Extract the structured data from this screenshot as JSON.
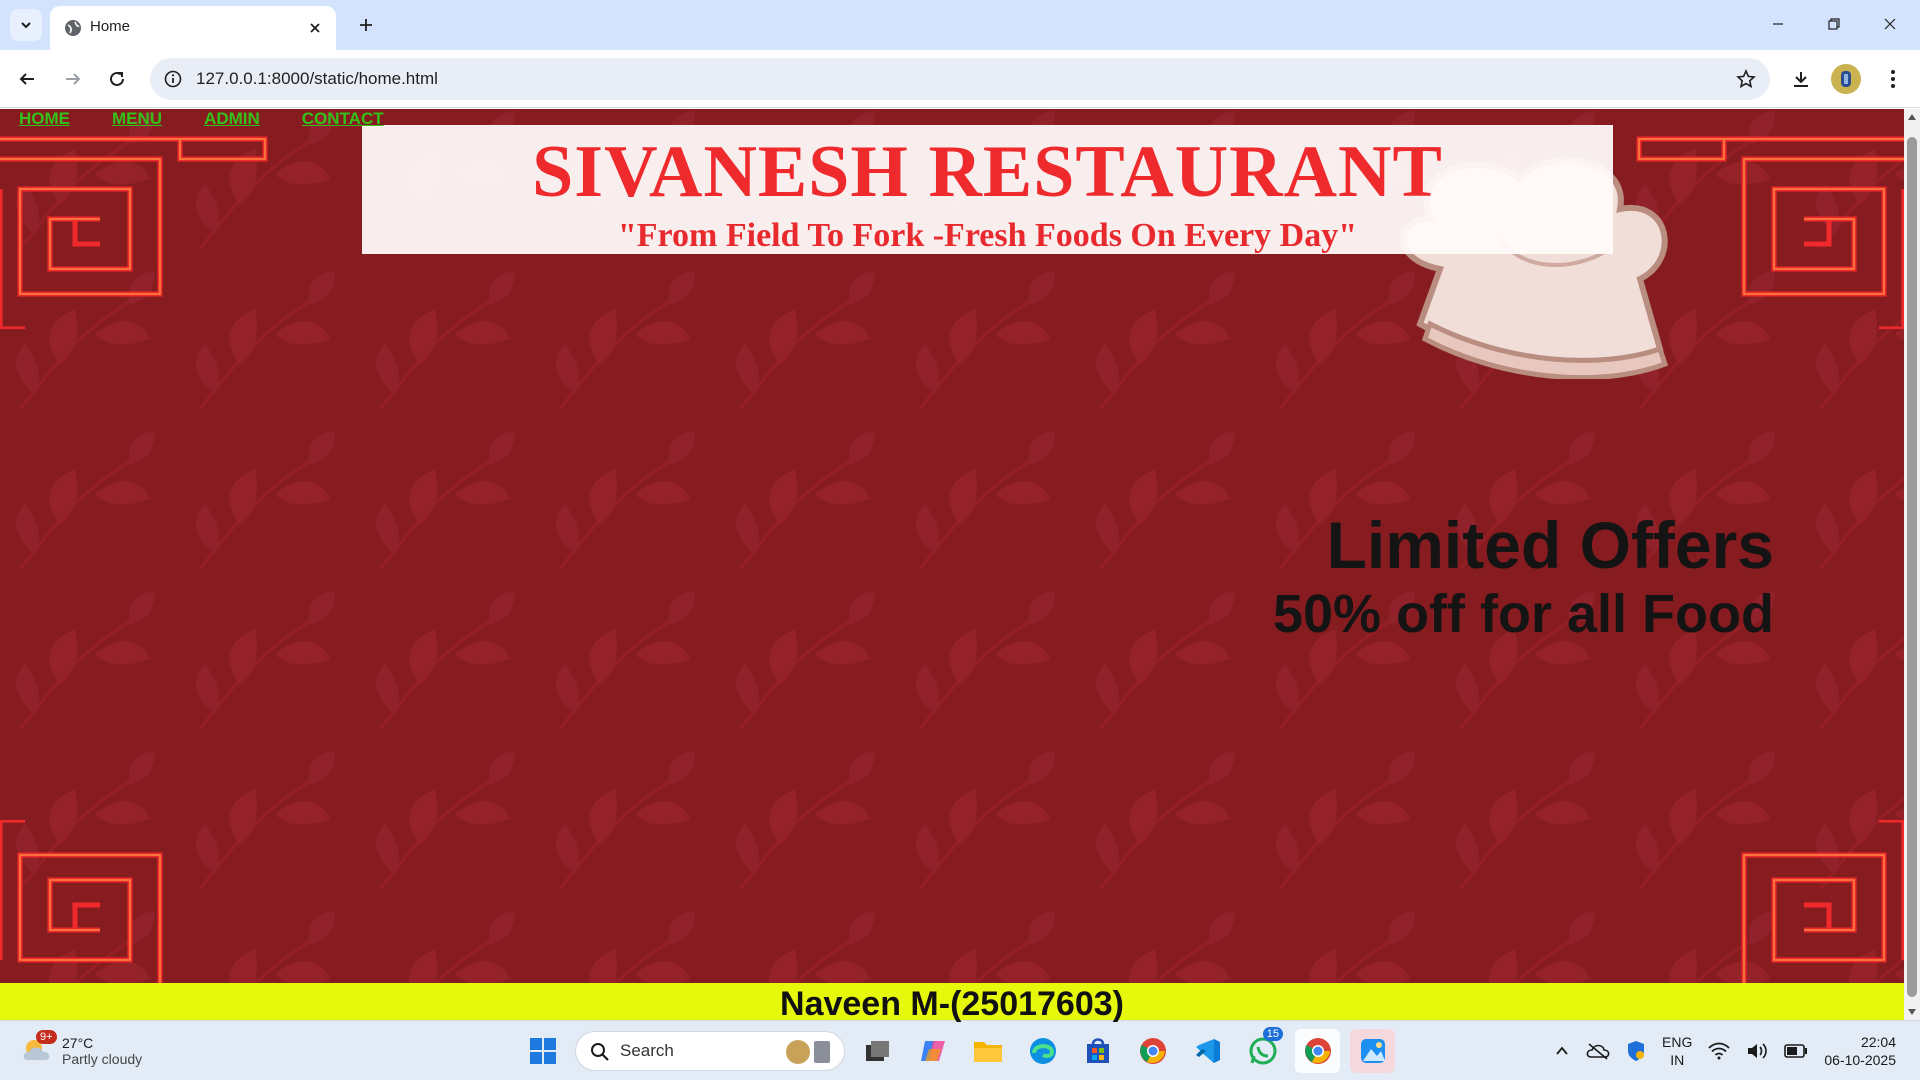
{
  "browser": {
    "tab_title": "Home",
    "url": "127.0.0.1:8000/static/home.html"
  },
  "page": {
    "nav": [
      "HOME",
      "MENU",
      "ADMIN",
      "CONTACT"
    ],
    "restaurant_name": "SIVANESH RESTAURANT",
    "tagline": "\"From Field To Fork -Fresh Foods On Every Day\"",
    "offer_title": "Limited Offers",
    "offer_detail": "50% off for all Food",
    "footer_text": "Naveen M-(25017603)"
  },
  "taskbar": {
    "weather_badge": "9+",
    "temperature": "27°C",
    "condition": "Partly cloudy",
    "search_label": "Search",
    "whatsapp_badge": "15",
    "language": "ENG",
    "region": "IN",
    "time": "22:04",
    "date": "06-10-2025"
  },
  "colors": {
    "page_background": "#871c20",
    "title_red": "#ef2a2d",
    "nav_green": "#32c21a",
    "footer_yellow": "#e6f80c"
  }
}
